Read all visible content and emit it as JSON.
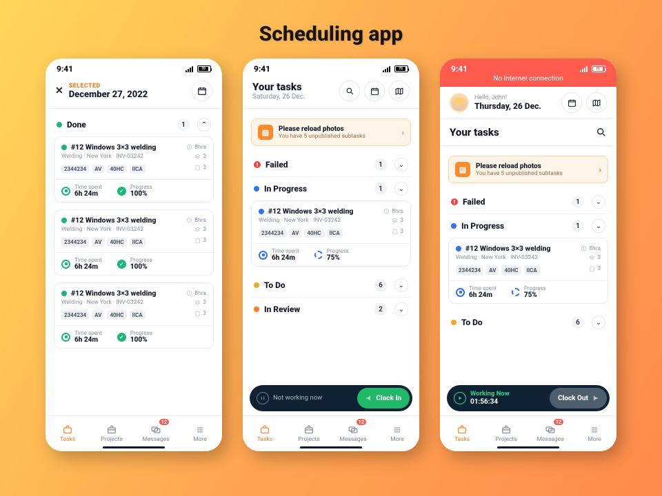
{
  "title": "Scheduling app",
  "statusTime": "9:41",
  "battery": "70",
  "noInternet": "No Internet connection",
  "screens": {
    "s1": {
      "selectedLabel": "SELECTED",
      "selectedDate": "December 27, 2022"
    },
    "s2": {
      "title": "Your tasks",
      "subtitle": "Saturday, 26 Dec."
    },
    "s3": {
      "hello": "Hello, John!",
      "today": "Thursday, 26 Dec.",
      "yourTasks": "Your tasks"
    }
  },
  "notice": {
    "title": "Please reload photos",
    "sub": "You have 5 unpublished subtasks"
  },
  "sections": {
    "done": "Done",
    "failed": "Failed",
    "inProgress": "In Progress",
    "todo": "To Do",
    "inReview": "In Review"
  },
  "counts": {
    "done": "1",
    "failed": "1",
    "inProgress": "1",
    "todo": "6",
    "inReview": "2"
  },
  "task": {
    "title": "#12 Windows 3×3 welding",
    "sub": "Welding · New York · INV-03242",
    "tags": [
      "2344234",
      "AV",
      "40HC",
      "IICA"
    ],
    "est": "8hrs",
    "subcount": "3",
    "files": "3",
    "timeLabel": "Time spent",
    "timeValue": "6h 24m",
    "progLabel": "Progress",
    "prog100": "100%",
    "prog75": "75%"
  },
  "float": {
    "idle": "Not working now",
    "clockin": "Clock In",
    "liveLabel": "Working Now",
    "liveTime": "01:56:34",
    "clockout": "Clock Out"
  },
  "nav": {
    "tasks": "Tasks",
    "projects": "Projects",
    "messages": "Messages",
    "more": "More",
    "badge": "12"
  }
}
